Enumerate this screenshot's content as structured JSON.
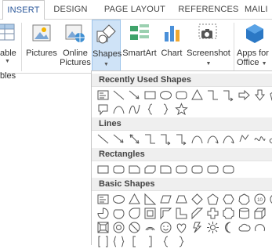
{
  "tabs": [
    "INSERT",
    "DESIGN",
    "PAGE LAYOUT",
    "REFERENCES",
    "MAILI"
  ],
  "ribbon": {
    "left_cut_top": "able",
    "left_cut_bottom": "bles",
    "pictures": "Pictures",
    "online_pictures_1": "Online",
    "online_pictures_2": "Pictures",
    "shapes": "Shapes",
    "smartart": "SmartArt",
    "chart": "Chart",
    "screenshot": "Screenshot",
    "apps_1": "Apps for",
    "apps_2": "Office"
  },
  "panel": {
    "recent": "Recently Used Shapes",
    "lines": "Lines",
    "rectangles": "Rectangles",
    "basic": "Basic Shapes"
  },
  "colors": {
    "accent": "#2b579a",
    "selected": "#cfe3f7",
    "section_bg": "#efefef"
  }
}
